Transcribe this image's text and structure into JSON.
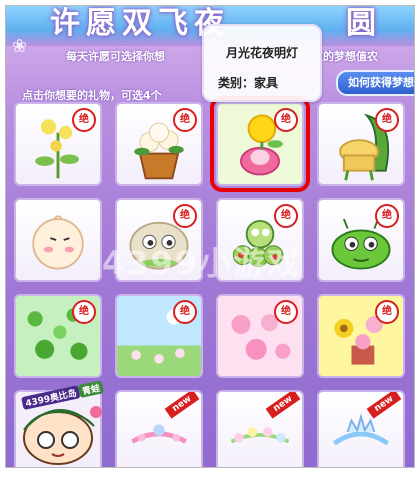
{
  "header": {
    "title_left": "许愿双飞夜",
    "title_right": "圆梦",
    "description": "每天许愿可选择你想",
    "description_tail": "愿望对应的梦想值农",
    "instruction": "点击你想要的礼物，可选4个",
    "how_to_get_button": "如何获得梦想"
  },
  "tooltip": {
    "item_name": "月光花夜明灯",
    "category": "类别：家具"
  },
  "grid": {
    "badge_label": "绝",
    "new_label": "new",
    "rows": [
      [
        {
          "name": "flower-plant",
          "badge": "jue",
          "selected": false
        },
        {
          "name": "potted-flowers",
          "badge": "jue",
          "selected": false
        },
        {
          "name": "moonflower-lamp",
          "badge": "jue",
          "selected": true
        },
        {
          "name": "leaf-chair",
          "badge": "jue",
          "selected": false
        }
      ],
      [
        {
          "name": "round-pet",
          "badge": "none",
          "selected": false
        },
        {
          "name": "blob-pet",
          "badge": "jue",
          "selected": false
        },
        {
          "name": "caterpillar-pet",
          "badge": "jue",
          "selected": false
        },
        {
          "name": "green-bug-pet",
          "badge": "jue",
          "selected": false
        }
      ],
      [
        {
          "name": "clover-background",
          "badge": "jue",
          "selected": false
        },
        {
          "name": "flower-meadow-background",
          "badge": "jue",
          "selected": false
        },
        {
          "name": "pink-flower-background",
          "badge": "jue",
          "selected": false
        },
        {
          "name": "sunflower-background",
          "badge": "jue",
          "selected": false
        }
      ],
      [
        {
          "name": "mascot-slot",
          "badge": "none",
          "selected": false
        },
        {
          "name": "pink-tiara",
          "badge": "new",
          "selected": false
        },
        {
          "name": "flower-crown",
          "badge": "new",
          "selected": false
        },
        {
          "name": "blue-tiara",
          "badge": "new",
          "selected": false
        }
      ]
    ]
  },
  "watermark": "4399小游戏",
  "mascot": {
    "badge_left": "4399奥比岛",
    "badge_right": "青蛙"
  },
  "colors": {
    "selection_border": "#e60000",
    "badge_red": "#d81e1e",
    "background_purple": "#a27ad6"
  }
}
